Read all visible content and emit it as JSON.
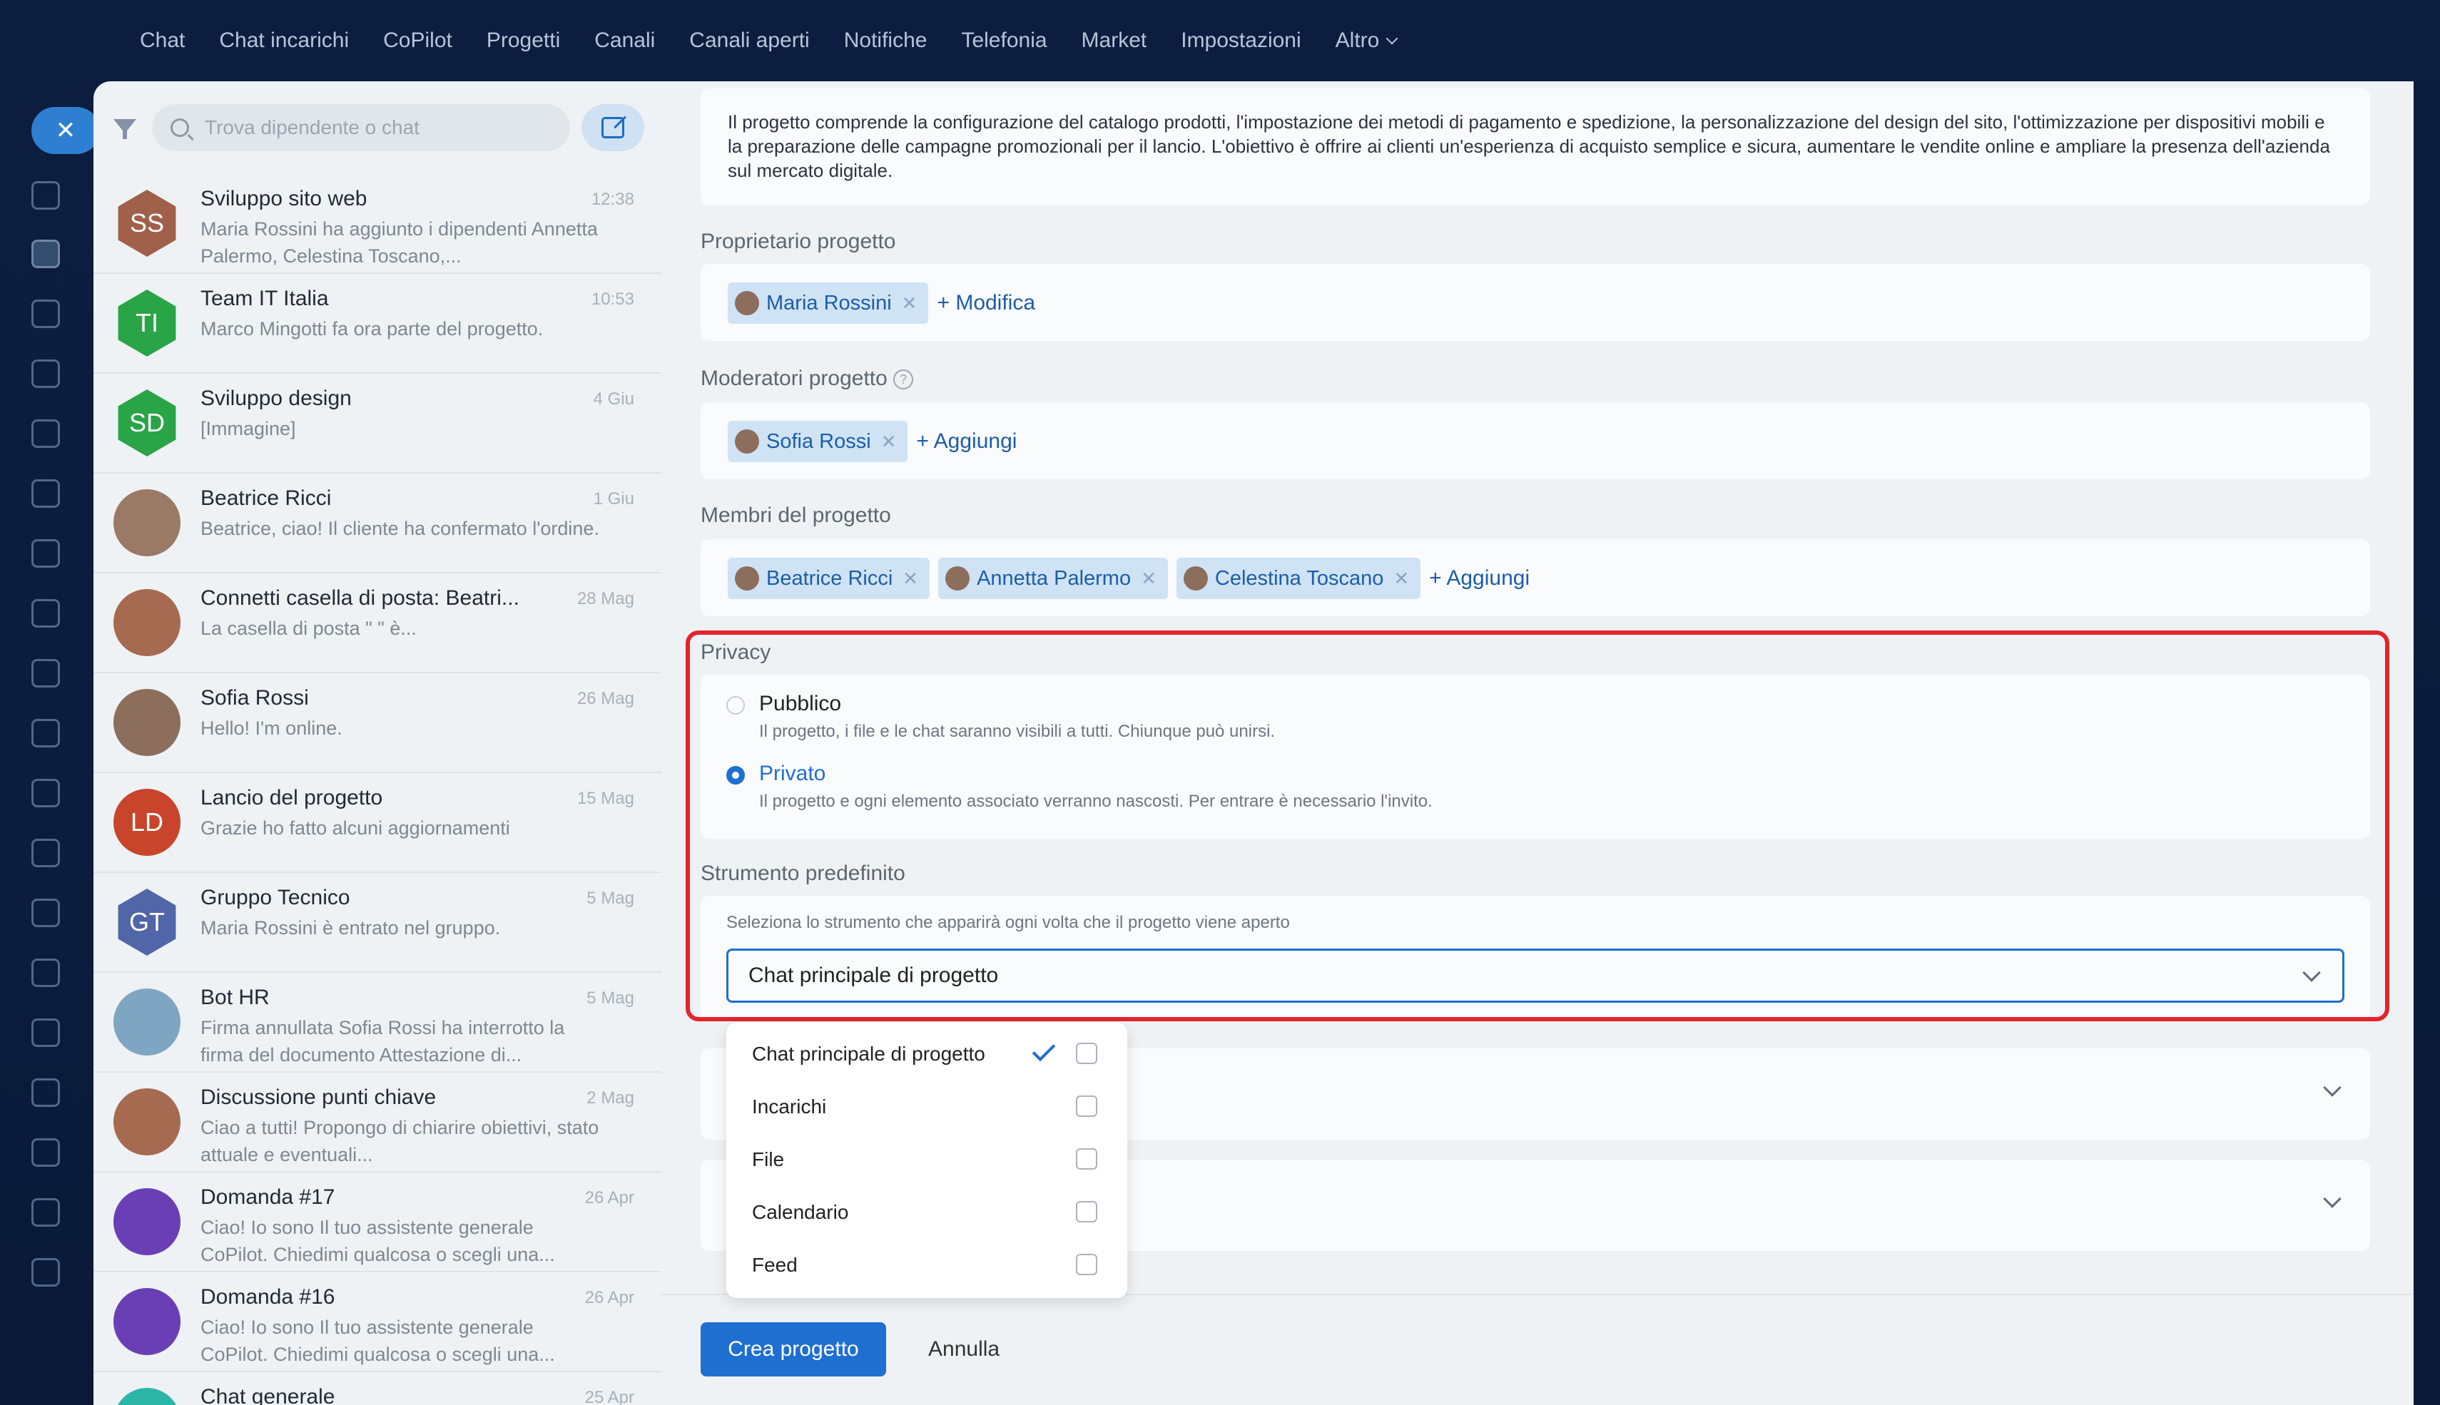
{
  "topnav": {
    "items": [
      "Chat",
      "Chat incarichi",
      "CoPilot",
      "Progetti",
      "Canali",
      "Canali aperti",
      "Notifiche",
      "Telefonia",
      "Market",
      "Impostazioni",
      "Altro"
    ]
  },
  "search": {
    "placeholder": "Trova dipendente o chat"
  },
  "chats": [
    {
      "name": "Sviluppo sito web",
      "time": "12:38",
      "preview": "Maria Rossini ha aggiunto i dipendenti Annetta Palermo, Celestina Toscano,...",
      "initials": "SS",
      "color": "#a0604a",
      "hex": true
    },
    {
      "name": "Team IT Italia",
      "time": "10:53",
      "preview": "Marco Mingotti fa ora parte del progetto.",
      "initials": "TI",
      "color": "#29a447",
      "hex": true
    },
    {
      "name": "Sviluppo design",
      "time": "4 Giu",
      "preview": "[Immagine]",
      "initials": "SD",
      "color": "#29a447",
      "hex": true
    },
    {
      "name": "Beatrice Ricci",
      "time": "1 Giu",
      "preview": "Beatrice, ciao! Il cliente ha confermato l'ordine.",
      "initials": "",
      "color": "#9a7a65",
      "hex": false
    },
    {
      "name": "Connetti casella di posta: Beatri...",
      "time": "28 Mag",
      "preview": "La casella di posta \" \" è...",
      "initials": "",
      "color": "#a56a50",
      "hex": false
    },
    {
      "name": "Sofia Rossi",
      "time": "26 Mag",
      "preview": "Hello! I'm online.",
      "initials": "",
      "color": "#8d6e5c",
      "hex": false
    },
    {
      "name": "Lancio del progetto",
      "time": "15 Mag",
      "preview": "Grazie ho fatto alcuni aggiornamenti",
      "initials": "LD",
      "color": "#c8452b",
      "hex": false
    },
    {
      "name": "Gruppo Tecnico",
      "time": "5 Mag",
      "preview": "Maria Rossini è entrato nel gruppo.",
      "initials": "GT",
      "color": "#5166a8",
      "hex": true
    },
    {
      "name": "Bot HR",
      "time": "5 Mag",
      "preview": "Firma annullata Sofia Rossi ha interrotto la firma del documento Attestazione di...",
      "initials": "",
      "color": "#7ea6c2",
      "hex": false
    },
    {
      "name": "Discussione punti chiave",
      "time": "2 Mag",
      "preview": "Ciao a tutti! Propongo di chiarire obiettivi, stato attuale e eventuali...",
      "initials": "",
      "color": "#a56a50",
      "hex": false
    },
    {
      "name": "Domanda #17",
      "time": "26 Apr",
      "preview": "Ciao! Io sono Il tuo assistente generale CoPilot. Chiedimi qualcosa o scegli una...",
      "initials": "",
      "color": "#6a3fb5",
      "hex": false
    },
    {
      "name": "Domanda #16",
      "time": "26 Apr",
      "preview": "Ciao! Io sono Il tuo assistente generale CoPilot. Chiedimi qualcosa o scegli una...",
      "initials": "",
      "color": "#6a3fb5",
      "hex": false
    },
    {
      "name": "Chat generale",
      "time": "25 Apr",
      "preview": "",
      "initials": "",
      "color": "#2bb6a8",
      "hex": false
    }
  ],
  "form": {
    "description": "Il progetto comprende la configurazione del catalogo prodotti, l'impostazione dei metodi di pagamento e spedizione, la personalizzazione del design del sito, l'ottimizzazione per dispositivi mobili e la preparazione delle campagne promozionali per il lancio. L'obiettivo è offrire ai clienti un'esperienza di acquisto semplice e sicura, aumentare le vendite online e ampliare la presenza dell'azienda sul mercato digitale.",
    "owner_label": "Proprietario progetto",
    "owner": "Maria Rossini",
    "owner_action": "+ Modifica",
    "mods_label": "Moderatori progetto",
    "mod": "Sofia Rossi",
    "add": "+ Aggiungi",
    "members_label": "Membri del progetto",
    "members": [
      "Beatrice Ricci",
      "Annetta Palermo",
      "Celestina Toscano"
    ],
    "privacy_label": "Privacy",
    "public_title": "Pubblico",
    "public_desc": "Il progetto, i file e le chat saranno visibili a tutti. Chiunque può unirsi.",
    "private_title": "Privato",
    "private_desc": "Il progetto e ogni elemento associato verranno nascosti. Per entrare è necessario l'invito.",
    "tool_label": "Strumento predefinito",
    "tool_hint": "Seleziona lo strumento che apparirà ogni volta che il progetto viene aperto",
    "tool_value": "Chat principale di progetto",
    "dropdown": [
      "Chat principale di progetto",
      "Incarichi",
      "File",
      "Calendario",
      "Feed"
    ],
    "create": "Crea progetto",
    "cancel": "Annulla"
  },
  "colors": {
    "accent": "#1f6fd1",
    "highlight": "#e5232b"
  }
}
